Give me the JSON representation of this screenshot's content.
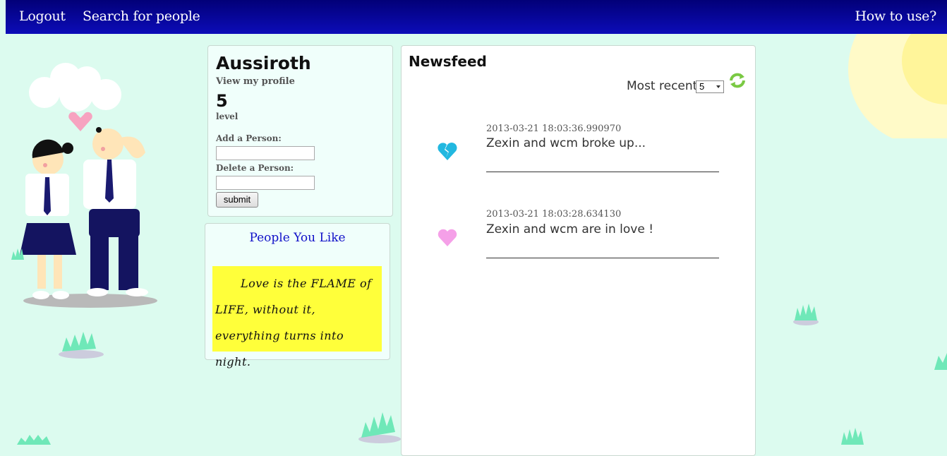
{
  "nav": {
    "logout": "Logout",
    "search": "Search for people",
    "help": "How to use?"
  },
  "profile": {
    "username": "Aussiroth",
    "view_profile": "View my profile",
    "level_value": "5",
    "level_label": "level",
    "add_label": "Add a Person:",
    "add_value": "",
    "delete_label": "Delete a Person:",
    "delete_value": "",
    "submit_label": "submit"
  },
  "likes": {
    "title": "People You Like",
    "quote": "Love is the FLAME of LIFE, without it, everything turns into night."
  },
  "feed": {
    "title": "Newsfeed",
    "recent_label": "Most recent",
    "recent_value": "5",
    "entries": [
      {
        "icon": "broken-heart-icon",
        "time": "2013-03-21 18:03:36.990970",
        "text": "Zexin and wcm broke up..."
      },
      {
        "icon": "heart-icon",
        "time": "2013-03-21 18:03:28.634130",
        "text": "Zexin and wcm are in love !"
      }
    ]
  },
  "colors": {
    "nav_bg": "#020078",
    "page_bg": "#dcfbef",
    "accent_blue": "#1010c8",
    "quote_bg": "#ffff3a",
    "broken_heart": "#22b8e0",
    "heart": "#f5a0e8"
  }
}
